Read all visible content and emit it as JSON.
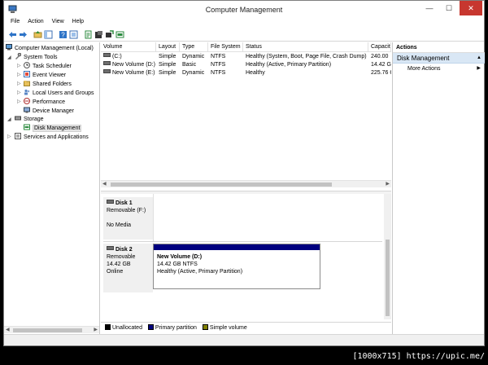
{
  "window": {
    "title": "Computer Management",
    "minimize": "—",
    "maximize": "☐",
    "close": "✕"
  },
  "menu": [
    "File",
    "Action",
    "View",
    "Help"
  ],
  "toolbar_icons": [
    "back-arrow-icon",
    "forward-arrow-icon",
    "up-folder-icon",
    "show-hide-tree-icon",
    "help-icon",
    "console-icon",
    "properties-icon",
    "export-icon",
    "connect-icon",
    "disk-view-icon"
  ],
  "tree": {
    "root": "Computer Management (Local)",
    "system_tools": "System Tools",
    "task_scheduler": "Task Scheduler",
    "event_viewer": "Event Viewer",
    "shared_folders": "Shared Folders",
    "local_users": "Local Users and Groups",
    "performance": "Performance",
    "device_manager": "Device Manager",
    "storage": "Storage",
    "disk_management": "Disk Management",
    "services": "Services and Applications"
  },
  "volume_list": {
    "columns": [
      "Volume",
      "Layout",
      "Type",
      "File System",
      "Status",
      "Capacit"
    ],
    "rows": [
      {
        "volume": "(C:)",
        "layout": "Simple",
        "type": "Dynamic",
        "fs": "NTFS",
        "status": "Healthy (System, Boot, Page File, Crash Dump)",
        "capacity": "240.00"
      },
      {
        "volume": "New Volume (D:)",
        "layout": "Simple",
        "type": "Basic",
        "fs": "NTFS",
        "status": "Healthy (Active, Primary Partition)",
        "capacity": "14.42 G"
      },
      {
        "volume": "New Volume (E:)",
        "layout": "Simple",
        "type": "Dynamic",
        "fs": "NTFS",
        "status": "Healthy",
        "capacity": "225.76 C"
      }
    ]
  },
  "disks": [
    {
      "name": "Disk 1",
      "line1": "Removable (F:)",
      "line2": "",
      "line3": "No Media"
    },
    {
      "name": "Disk 2",
      "line1": "Removable",
      "line2": "14.42 GB",
      "line3": "Online",
      "partition": {
        "name": "New Volume  (D:)",
        "size": "14.42 GB NTFS",
        "status": "Healthy (Active, Primary Partition)"
      }
    }
  ],
  "legend": [
    {
      "label": "Unallocated",
      "color": "#000000"
    },
    {
      "label": "Primary partition",
      "color": "#00007f"
    },
    {
      "label": "Simple volume",
      "color": "#7f7f00"
    }
  ],
  "actions": {
    "header": "Actions",
    "group": "Disk Management",
    "more": "More Actions"
  },
  "watermark": "[1000x715] https://upic.me/"
}
